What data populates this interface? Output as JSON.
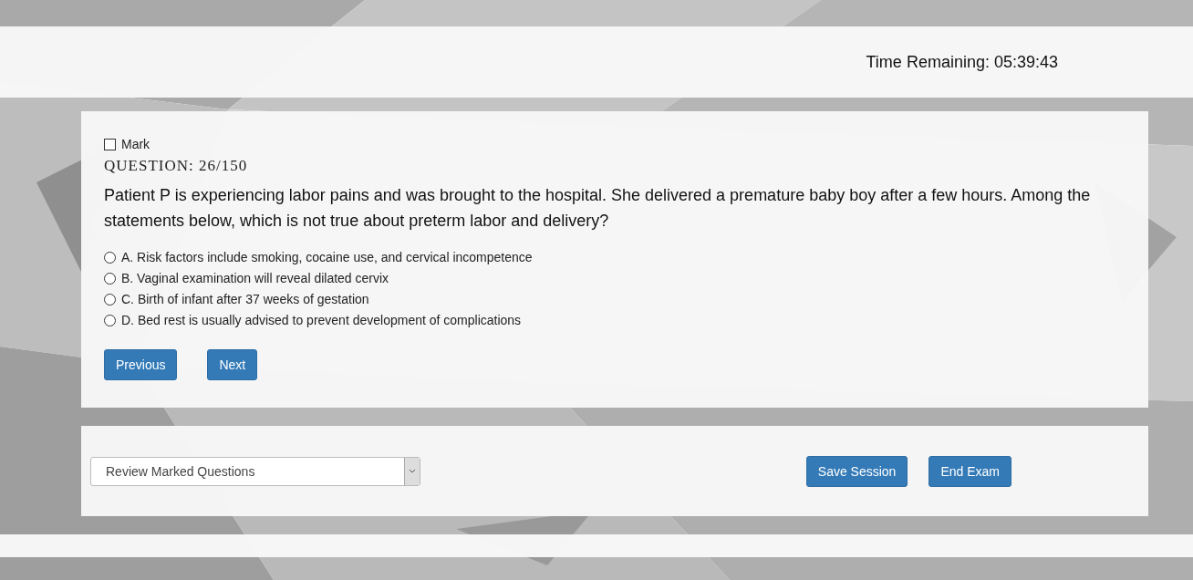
{
  "header": {
    "timer_label": "Time Remaining: 05:39:43"
  },
  "question": {
    "mark": {
      "label": "Mark",
      "checked": false
    },
    "number": "QUESTION: 26/150",
    "text": "Patient P is experiencing labor pains and was brought to the hospital. She delivered a premature baby boy after a few hours. Among the statements below, which is not true about preterm labor and delivery?",
    "options": [
      {
        "label": "A. Risk factors include smoking, cocaine use, and cervical incompetence",
        "selected": false
      },
      {
        "label": "B. Vaginal examination will reveal dilated cervix",
        "selected": false
      },
      {
        "label": "C. Birth of infant after 37 weeks of gestation",
        "selected": false
      },
      {
        "label": "D. Bed rest is usually advised to prevent development of complications",
        "selected": false
      }
    ],
    "buttons": [
      "Previous",
      "Next"
    ]
  },
  "footer": {
    "review_select": {
      "value": "Review Marked Questions"
    },
    "buttons": [
      "Save Session",
      "End Exam"
    ]
  }
}
